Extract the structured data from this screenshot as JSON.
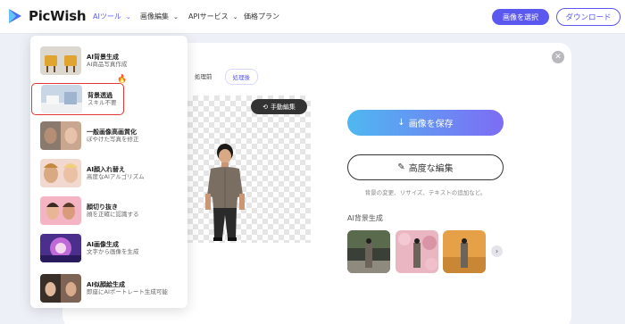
{
  "header": {
    "brand": "PicWish",
    "nav": [
      {
        "label": "AIツール",
        "chevron": true,
        "active": true
      },
      {
        "label": "画像編集",
        "chevron": true,
        "active": false
      },
      {
        "label": "APIサービス",
        "chevron": true,
        "active": false
      },
      {
        "label": "価格プラン",
        "chevron": false,
        "active": false
      }
    ],
    "select_button": "画像を選択",
    "download_button": "ダウンロード"
  },
  "menu": {
    "items": [
      {
        "title": "AI背景生成",
        "desc": "AI商品写真作成",
        "hot": true,
        "selected": false
      },
      {
        "title": "背景透過",
        "desc": "スキル不要",
        "hot": false,
        "selected": true
      },
      {
        "title": "一般画像高画質化",
        "desc": "ぼやけた写真を修正",
        "hot": false,
        "selected": false
      },
      {
        "title": "AI顔入れ替え",
        "desc": "高度なAIアルゴリズム",
        "hot": false,
        "selected": false
      },
      {
        "title": "顔切り抜き",
        "desc": "顔を正確に認識する",
        "hot": false,
        "selected": false
      },
      {
        "title": "AI画像生成",
        "desc": "文字から画像を生成",
        "hot": false,
        "selected": false
      },
      {
        "title": "AI似顔絵生成",
        "desc": "即座にAIポートレート生成可能",
        "hot": false,
        "selected": false
      }
    ]
  },
  "editor": {
    "tabs": [
      "処理前",
      "処理後"
    ],
    "active_tab": "処理後",
    "manual_edit_button": "手動編集",
    "save_button": "画像を保存",
    "edit_button": "高度な編集",
    "hint": "背景の変更、リサイズ、テキストの追加など。",
    "section_title": "AI背景生成"
  },
  "colors": {
    "accent": "#5b58f0",
    "save_gradient_start": "#4fb8f0",
    "save_gradient_end": "#7d6cf5",
    "selection_border": "#e53636"
  },
  "icons": {
    "close": "close-icon",
    "download": "download-arrow-icon",
    "edit": "magic-wand-icon",
    "manual_edit": "history-icon",
    "next": "chevron-right-icon"
  }
}
